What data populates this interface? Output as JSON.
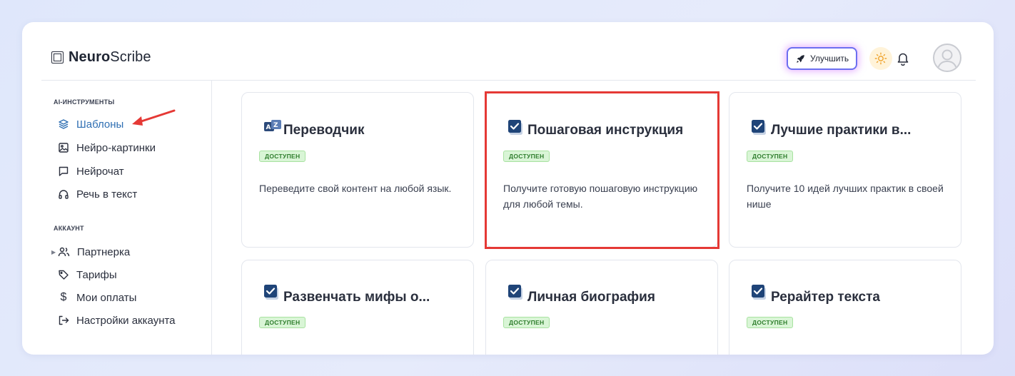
{
  "app": {
    "brand_bold": "Neuro",
    "brand_rest": "Scribe"
  },
  "header": {
    "upgrade_label": "Улучшить"
  },
  "sidebar": {
    "sections": [
      {
        "title": "AI-ИНСТРУМЕНТЫ",
        "items": [
          {
            "label": "Шаблоны",
            "icon": "layers-icon",
            "active": true
          },
          {
            "label": "Нейро-картинки",
            "icon": "image-icon"
          },
          {
            "label": "Нейрочат",
            "icon": "chat-icon"
          },
          {
            "label": "Речь в текст",
            "icon": "headphones-icon"
          }
        ]
      },
      {
        "title": "АККАУНТ",
        "items": [
          {
            "label": "Партнерка",
            "icon": "users-icon",
            "expandable": true
          },
          {
            "label": "Тарифы",
            "icon": "tag-icon"
          },
          {
            "label": "Мои оплаты",
            "icon": "dollar-icon"
          },
          {
            "label": "Настройки аккаунта",
            "icon": "logout-icon"
          }
        ]
      }
    ]
  },
  "templates": [
    {
      "title": "Переводчик",
      "icon": "translate-icon",
      "status": "ДОСТУПЕН",
      "description": "Переведите свой контент на любой язык."
    },
    {
      "title": "Пошаговая инструкция",
      "icon": "checkbox-icon",
      "status": "ДОСТУПЕН",
      "description": "Получите готовую пошаговую инструкцию для любой темы."
    },
    {
      "title": "Лучшие практики в...",
      "icon": "checkbox-icon",
      "status": "ДОСТУПЕН",
      "description": "Получите 10 идей лучших практик в своей нише"
    },
    {
      "title": "Развенчать мифы о...",
      "icon": "checkbox-icon",
      "status": "ДОСТУПЕН",
      "description": ""
    },
    {
      "title": "Личная биография",
      "icon": "checkbox-icon",
      "status": "ДОСТУПЕН",
      "description": ""
    },
    {
      "title": "Рерайтер текста",
      "icon": "checkbox-icon",
      "status": "ДОСТУПЕН",
      "description": ""
    }
  ],
  "colors": {
    "accent": "#2f6fb3",
    "badge_bg": "#d9f5d6",
    "badge_text": "#2e7d2c",
    "highlight": "#e53935",
    "upgrade_border": "#6b6ff0"
  }
}
